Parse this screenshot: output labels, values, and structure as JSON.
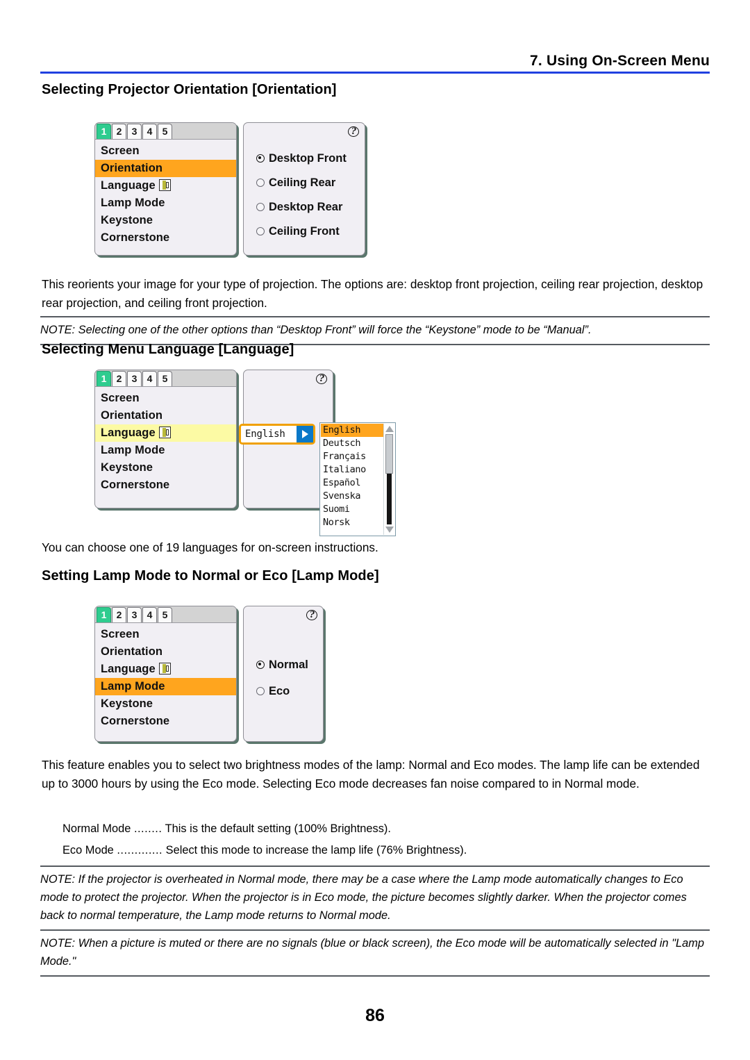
{
  "header": {
    "title": "7. Using On-Screen Menu",
    "rule_color": "#2040e0"
  },
  "page_number": "86",
  "sections": {
    "orientation": {
      "heading": "Selecting Projector Orientation [Orientation]",
      "paragraph": "This reorients your image for your type of projection. The options are: desktop front projection, ceiling rear projection, desktop rear projection, and ceiling front projection.",
      "note": "NOTE: Selecting one of the other options than “Desktop Front” will force the “Keystone” mode to be “Manual”."
    },
    "language": {
      "heading": "Selecting Menu Language [Language]",
      "paragraph": "You can choose one of 19 languages for on-screen instructions."
    },
    "lamp_mode": {
      "heading": "Setting Lamp Mode to Normal or Eco [Lamp Mode]",
      "paragraph": "This feature enables you to select two brightness modes of the lamp: Normal and Eco modes. The lamp life can be extended up to 3000 hours by using the Eco mode. Selecting Eco mode decreases fan noise compared to in Normal mode.",
      "mode_rows": [
        {
          "label": "Normal Mode",
          "dots": "........",
          "desc": "This is the default setting (100% Brightness)."
        },
        {
          "label": "Eco Mode",
          "dots": ".............",
          "desc": "Select this mode to increase the lamp life (76% Brightness)."
        }
      ],
      "note_overheat": "NOTE: If the projector is overheated in Normal mode, there may be a case where the Lamp mode automatically changes to Eco mode to protect the projector. When the projector is in Eco mode, the picture becomes slightly darker. When the projector comes back to normal temperature, the Lamp mode returns to Normal mode.",
      "note_muted": "NOTE: When a picture is muted or there are no signals (blue or black screen), the Eco mode will be automatically selected in \"Lamp Mode.\""
    }
  },
  "osd": {
    "tabs": [
      "1",
      "2",
      "3",
      "4",
      "5"
    ],
    "active_tab": "1",
    "menu_items": [
      "Screen",
      "Orientation",
      "Language",
      "Lamp Mode",
      "Keystone",
      "Cornerstone"
    ],
    "help_glyph": "?",
    "colors": {
      "active_tab": "#2ecc8f",
      "highlight_orange": "#ffa51e",
      "highlight_yellow": "#fcfaa4",
      "combo_border": "#f0a000",
      "combo_arrow": "#0a78c8"
    },
    "orientation_widget": {
      "highlighted_item": "Orientation",
      "options": [
        "Desktop Front",
        "Ceiling Rear",
        "Desktop Rear",
        "Ceiling Front"
      ],
      "selected_option": "Desktop Front"
    },
    "language_widget": {
      "highlighted_item": "Language",
      "combo_value": "English",
      "dropdown_options": [
        "English",
        "Deutsch",
        "Français",
        "Italiano",
        "Español",
        "Svenska",
        "Suomi",
        "Norsk"
      ],
      "selected_option": "English"
    },
    "lamp_widget": {
      "highlighted_item": "Lamp Mode",
      "options": [
        "Normal",
        "Eco"
      ],
      "selected_option": "Normal"
    }
  }
}
